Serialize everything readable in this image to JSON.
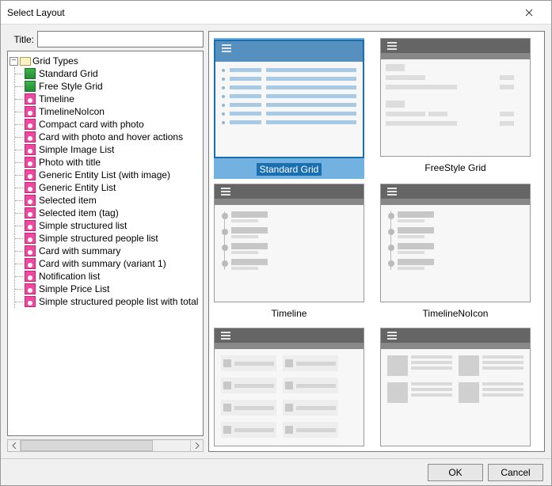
{
  "window": {
    "title": "Select Layout"
  },
  "title_field": {
    "label": "Title:",
    "value": ""
  },
  "tree": {
    "expand": "−",
    "root": "Grid Types",
    "items": [
      {
        "label": "Standard Grid",
        "icon": "green"
      },
      {
        "label": "Free Style Grid",
        "icon": "green"
      },
      {
        "label": "Timeline",
        "icon": "pink"
      },
      {
        "label": "TimelineNoIcon",
        "icon": "pink"
      },
      {
        "label": "Compact card with photo",
        "icon": "pink"
      },
      {
        "label": "Card with photo and hover actions",
        "icon": "pink"
      },
      {
        "label": "Simple Image List",
        "icon": "pink"
      },
      {
        "label": "Photo with title",
        "icon": "pink"
      },
      {
        "label": "Generic Entity List (with image)",
        "icon": "pink"
      },
      {
        "label": "Generic Entity List",
        "icon": "pink"
      },
      {
        "label": "Selected item",
        "icon": "pink"
      },
      {
        "label": "Selected item (tag)",
        "icon": "pink"
      },
      {
        "label": "Simple structured list",
        "icon": "pink"
      },
      {
        "label": "Simple structured people list",
        "icon": "pink"
      },
      {
        "label": "Card with summary",
        "icon": "pink"
      },
      {
        "label": "Card with summary (variant 1)",
        "icon": "pink"
      },
      {
        "label": "Notification list",
        "icon": "pink"
      },
      {
        "label": "Simple Price List",
        "icon": "pink"
      },
      {
        "label": "Simple structured people list with total",
        "icon": "pink"
      }
    ]
  },
  "gallery": [
    {
      "label": "Standard Grid",
      "kind": "grid",
      "selected": true
    },
    {
      "label": "FreeStyle Grid",
      "kind": "free"
    },
    {
      "label": "Timeline",
      "kind": "timeline"
    },
    {
      "label": "TimelineNoIcon",
      "kind": "timeline"
    },
    {
      "label": "",
      "kind": "cards"
    },
    {
      "label": "",
      "kind": "bigcards"
    }
  ],
  "buttons": {
    "ok": "OK",
    "cancel": "Cancel"
  }
}
